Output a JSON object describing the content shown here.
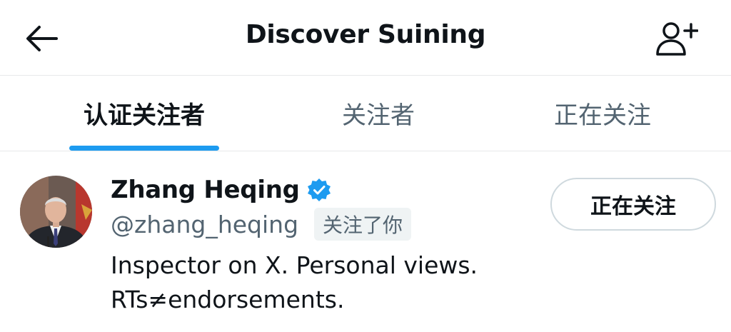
{
  "header": {
    "title": "Discover Suining",
    "back_icon": "arrow-left-icon",
    "follow_icon": "person-add-icon"
  },
  "tabs": [
    {
      "label": "认证关注者",
      "active": true
    },
    {
      "label": "关注者",
      "active": false
    },
    {
      "label": "正在关注",
      "active": false
    }
  ],
  "user": {
    "name": "Zhang Heqing",
    "verified_icon": "verified-badge-icon",
    "handle": "@zhang_heqing",
    "follows_you": "关注了你",
    "bio_line1": "Inspector on X. Personal views.",
    "bio_line2": "RTs≠endorsements.",
    "follow_button": "正在关注"
  },
  "colors": {
    "accent": "#1d9bf0",
    "text": "#0f1419",
    "secondary": "#536471",
    "border": "#e7e9ea"
  }
}
